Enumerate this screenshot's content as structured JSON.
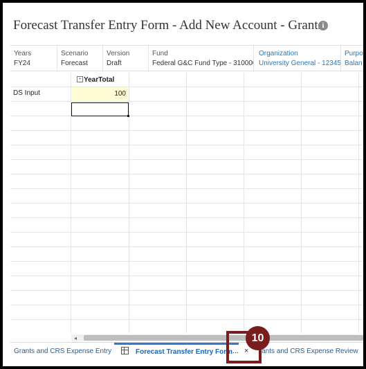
{
  "form": {
    "title": "Forecast Transfer Entry Form - Add New Account - Grants"
  },
  "pov": [
    {
      "label": "Years",
      "value": "FY24",
      "link": false
    },
    {
      "label": "Scenario",
      "value": "Forecast",
      "link": false
    },
    {
      "label": "Version",
      "value": "Draft",
      "link": false
    },
    {
      "label": "Fund",
      "value": "Federal G&C Fund Type - 310000",
      "link": false
    },
    {
      "label": "Organization",
      "value": "University General - 12345",
      "link": true
    },
    {
      "label": "Purpo",
      "value": "Balan",
      "link": true
    }
  ],
  "grid": {
    "column_header": "YearTotal",
    "expand_symbol": "+",
    "rows": [
      {
        "label": "DS Input",
        "value": "100"
      }
    ]
  },
  "scroll": {
    "left_arrow": "◂"
  },
  "tabs": [
    {
      "label": "Grants and CRS Expense Entry",
      "active": false
    },
    {
      "label": "Forecast Transfer Entry Form",
      "active": true
    },
    {
      "label": "Grants and CRS Expense Review",
      "active": false
    }
  ],
  "tab_ellipsis": "...",
  "tab_close": "×",
  "callout": {
    "number": "10",
    "color": "#7a1d1d"
  },
  "colors": {
    "accent": "#2e7bd6",
    "data_cell": "#fffbd4",
    "link": "#2a78b8"
  }
}
